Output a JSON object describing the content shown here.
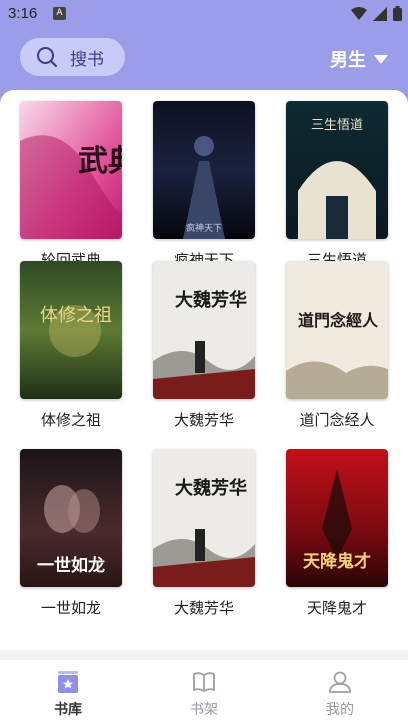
{
  "status": {
    "time": "3:16",
    "notif": "A"
  },
  "header": {
    "search_label": "搜书",
    "gender": "男生"
  },
  "books": [
    {
      "title": "轮回武典",
      "cover_text": "武典"
    },
    {
      "title": "疯神天下",
      "cover_text": "疯神天下"
    },
    {
      "title": "三生悟道",
      "cover_text": "三生悟道"
    },
    {
      "title": "体修之祖",
      "cover_text": "体修之祖"
    },
    {
      "title": "大魏芳华",
      "cover_text": "大魏芳华"
    },
    {
      "title": "道门念经人",
      "cover_text": "道門念經人"
    },
    {
      "title": "一世如龙",
      "cover_text": "一世如龙"
    },
    {
      "title": "大魏芳华",
      "cover_text": "大魏芳华"
    },
    {
      "title": "天降鬼才",
      "cover_text": "天降鬼才"
    }
  ],
  "tabs": [
    {
      "label": "书库",
      "active": true
    },
    {
      "label": "书架",
      "active": false
    },
    {
      "label": "我的",
      "active": false
    }
  ],
  "colors": {
    "accent": "#9b9de8",
    "search_bg": "#c8cbf7"
  }
}
